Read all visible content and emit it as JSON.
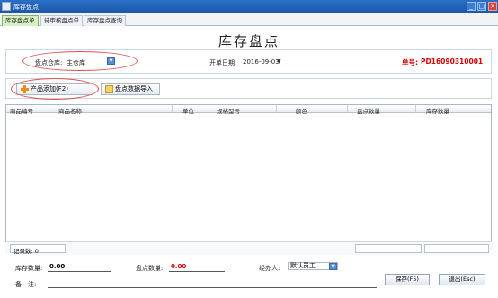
{
  "window": {
    "title": "库存盘点"
  },
  "tabs": [
    {
      "label": "库存盘点单",
      "active": true
    },
    {
      "label": "待审核盘点单",
      "active": false
    },
    {
      "label": "库存盘点查询",
      "active": false
    }
  ],
  "page_title": "库存盘点",
  "info": {
    "warehouse_label": "盘点仓库:",
    "warehouse_value": "主仓库",
    "date_label": "开单日期:",
    "date_value": "2016-09-03",
    "order_label": "单号:",
    "order_value": "PD16090310001"
  },
  "toolbar": {
    "add_label": "产品添加(F2)",
    "import_label": "盘点数据导入"
  },
  "grid": {
    "columns": [
      "商品编号",
      "商品名称",
      "单位",
      "规格型号",
      "颜色",
      "盘点数量",
      "库存数量"
    ],
    "rows": []
  },
  "footer": {
    "record_count_label": "记录数: 0"
  },
  "summary": {
    "stock_qty_label": "库存数量:",
    "stock_qty_value": "0.00",
    "count_qty_label": "盘点数量:",
    "count_qty_value": "0.00",
    "handler_label": "经办人:",
    "handler_value": "默认员工",
    "note_label": "备　注:",
    "save_label": "保存(F5)",
    "exit_label": "退出(Esc)"
  },
  "colors": {
    "accent_red": "#d40000",
    "tab_active": "#d7f0c0",
    "titlebar": "#1a56a8"
  }
}
